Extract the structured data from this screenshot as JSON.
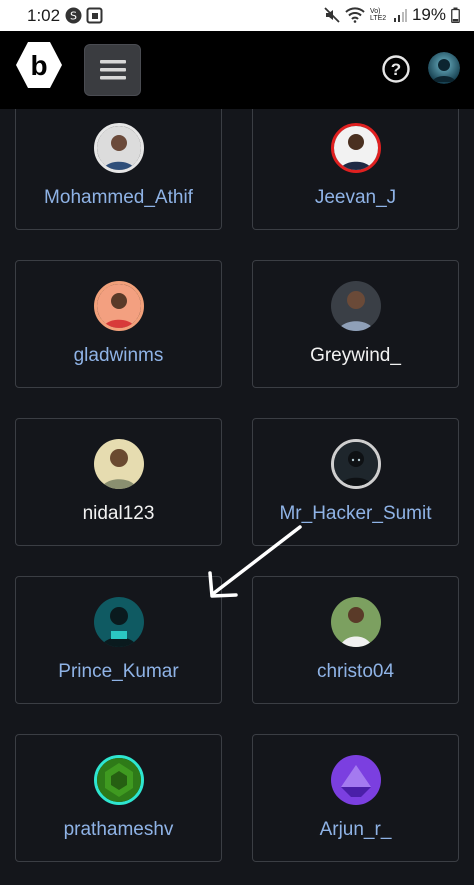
{
  "status_bar": {
    "time": "1:02",
    "network_label": "Vo) LTE2",
    "battery_percent": "19%"
  },
  "header": {
    "logo_letter": "b",
    "help_symbol": "?"
  },
  "users": [
    {
      "name": "Mohammed_Athif",
      "name_color": "#8fb3e6",
      "ring": "#e6e6e6"
    },
    {
      "name": "Jeevan_J",
      "name_color": "#8fb3e6",
      "ring": "#e02020"
    },
    {
      "name": "gladwinms",
      "name_color": "#8fb3e6",
      "ring": "#f2a07a"
    },
    {
      "name": "Greywind_",
      "name_color": "#f2f2f2",
      "ring": "none"
    },
    {
      "name": "nidal123",
      "name_color": "#f2f2f2",
      "ring": "none"
    },
    {
      "name": "Mr_Hacker_Sumit",
      "name_color": "#8fb3e6",
      "ring": "#cfcfcf"
    },
    {
      "name": "Prince_Kumar",
      "name_color": "#8fb3e6",
      "ring": "none"
    },
    {
      "name": "christo04",
      "name_color": "#8fb3e6",
      "ring": "none"
    },
    {
      "name": "prathameshv",
      "name_color": "#8fb3e6",
      "ring": "#2ee6d0"
    },
    {
      "name": "Arjun_r_",
      "name_color": "#8fb3e6",
      "ring": "none"
    }
  ]
}
